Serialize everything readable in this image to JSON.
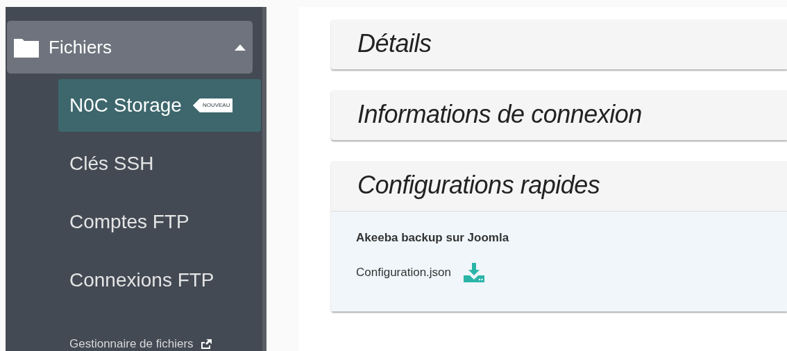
{
  "sidebar": {
    "group": {
      "label": "Fichiers",
      "expanded": true
    },
    "items": [
      {
        "label": "N0C Storage",
        "selected": true,
        "badge": "NOUVEAU"
      },
      {
        "label": "Clés SSH",
        "selected": false
      },
      {
        "label": "Comptes FTP",
        "selected": false
      },
      {
        "label": "Connexions FTP",
        "selected": false
      },
      {
        "label": "Gestionnaire de fichiers",
        "selected": false,
        "kind": "external"
      }
    ]
  },
  "panels": [
    {
      "title": "Détails"
    },
    {
      "title": "Informations de connexion"
    },
    {
      "title": "Configurations rapides",
      "body": {
        "heading": "Akeeba backup sur Joomla",
        "file": "Configuration.json"
      }
    }
  ]
}
